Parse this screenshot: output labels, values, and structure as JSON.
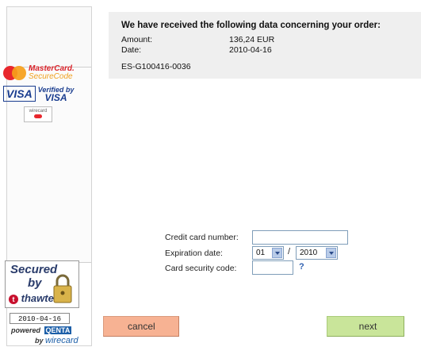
{
  "sidebar": {
    "mastercard_title": "MasterCard.",
    "mastercard_sub": "SecureCode",
    "visa": "VISA",
    "vbv_line1": "Verified by",
    "vbv_line2": "VISA",
    "wirecard_small": "wirecard",
    "thawte_secured": "Secured",
    "thawte_by": "by",
    "thawte_brand": "thawte",
    "thawte_date": "2010-04-16",
    "powered": "powered",
    "qenta": "QENTA",
    "by": "by",
    "wirecard": "wirecard"
  },
  "order": {
    "heading": "We have received the following data concerning your order:",
    "amount_label": "Amount:",
    "amount_value": "136,24  EUR",
    "date_label": "Date:",
    "date_value": "2010-04-16",
    "reference": "ES-G100416-0036"
  },
  "form": {
    "card_number_label": "Credit card number:",
    "card_number_value": "",
    "expiration_label": "Expiration date:",
    "month_value": "01",
    "separator": "/",
    "year_value": "2010",
    "cvc_label": "Card security code:",
    "cvc_value": "",
    "help": "?"
  },
  "buttons": {
    "cancel": "cancel",
    "next": "next"
  },
  "colors": {
    "cancel_bg": "#f7b293",
    "next_bg": "#c9e59a",
    "order_box_bg": "#efefef",
    "help_link": "#2d5fb0"
  }
}
